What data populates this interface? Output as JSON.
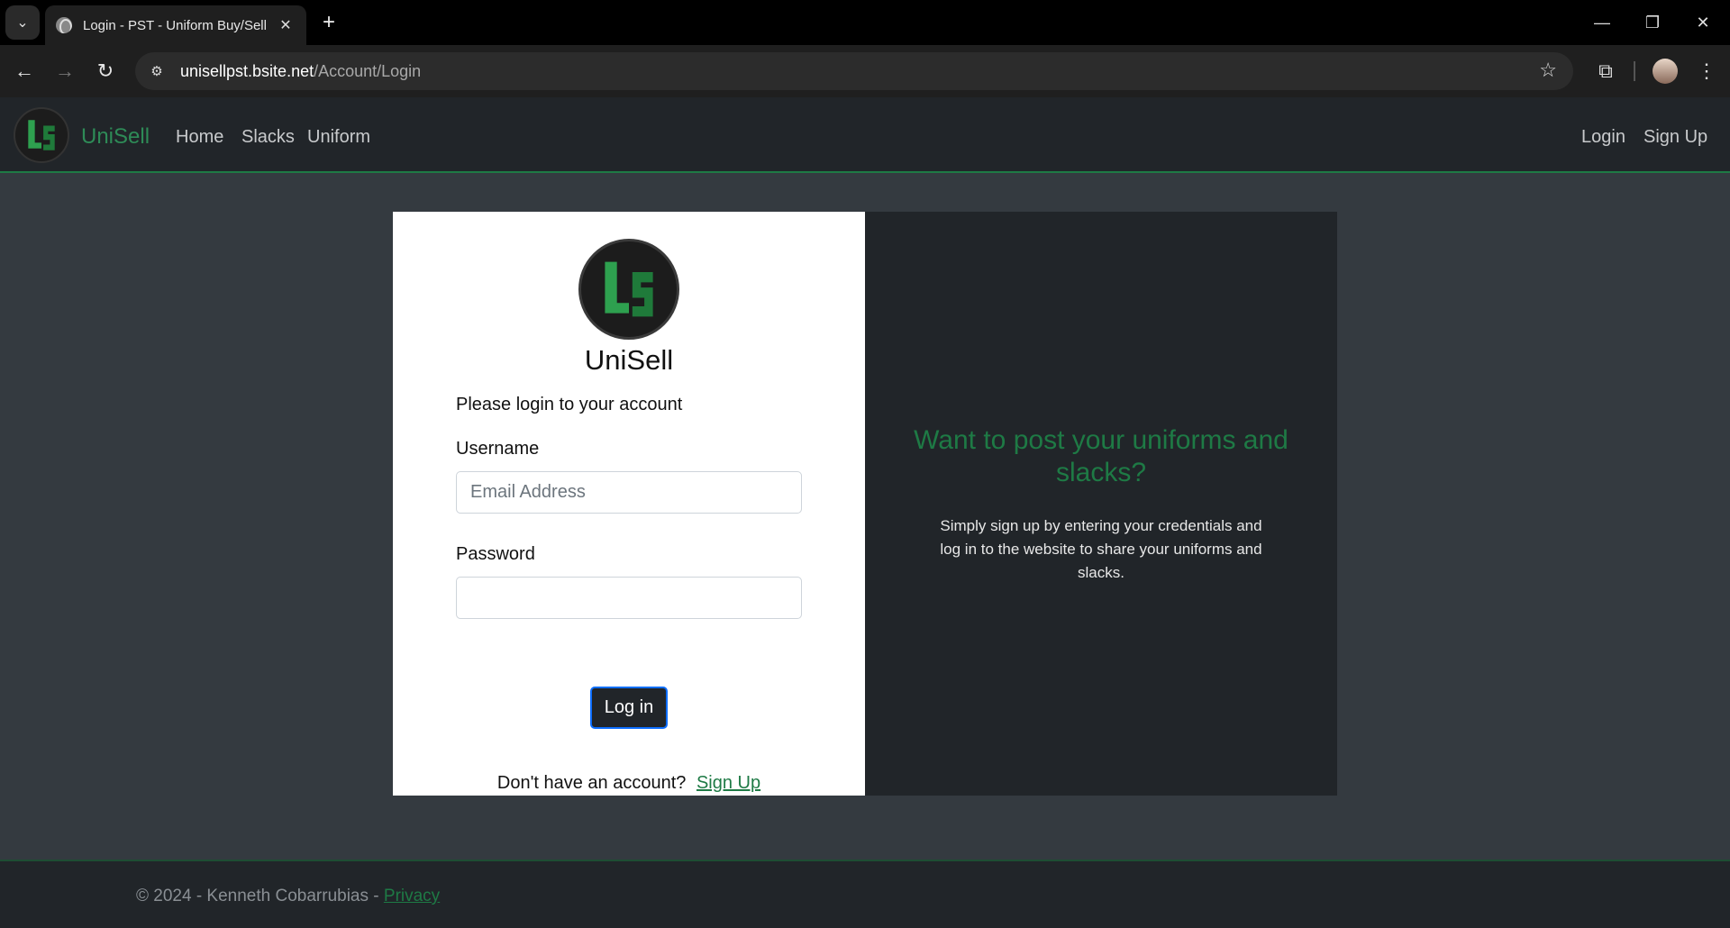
{
  "browser": {
    "tab_title": "Login - PST - Uniform Buy/Sell",
    "url_host": "unisellpst.bsite.net",
    "url_path": "/Account/Login"
  },
  "nav": {
    "brand": "UniSell",
    "links": [
      "Home",
      "Slacks",
      "Uniform"
    ],
    "right_links": [
      "Login",
      "Sign Up"
    ],
    "accent_color": "#1e7a45"
  },
  "login": {
    "app_name": "UniSell",
    "prompt": "Please login to your account",
    "username_label": "Username",
    "username_placeholder": "Email Address",
    "username_value": "",
    "password_label": "Password",
    "password_value": "",
    "submit_label": "Log in",
    "signup_prompt": "Don't have an account?",
    "signup_link": "Sign Up"
  },
  "promo": {
    "title": "Want to post your uniforms and slacks?",
    "text": "Simply sign up by entering your credentials and log in to the website to share your uniforms and slacks."
  },
  "footer": {
    "copyright": "© 2024 - Kenneth Cobarrubias - ",
    "privacy_link": "Privacy"
  }
}
